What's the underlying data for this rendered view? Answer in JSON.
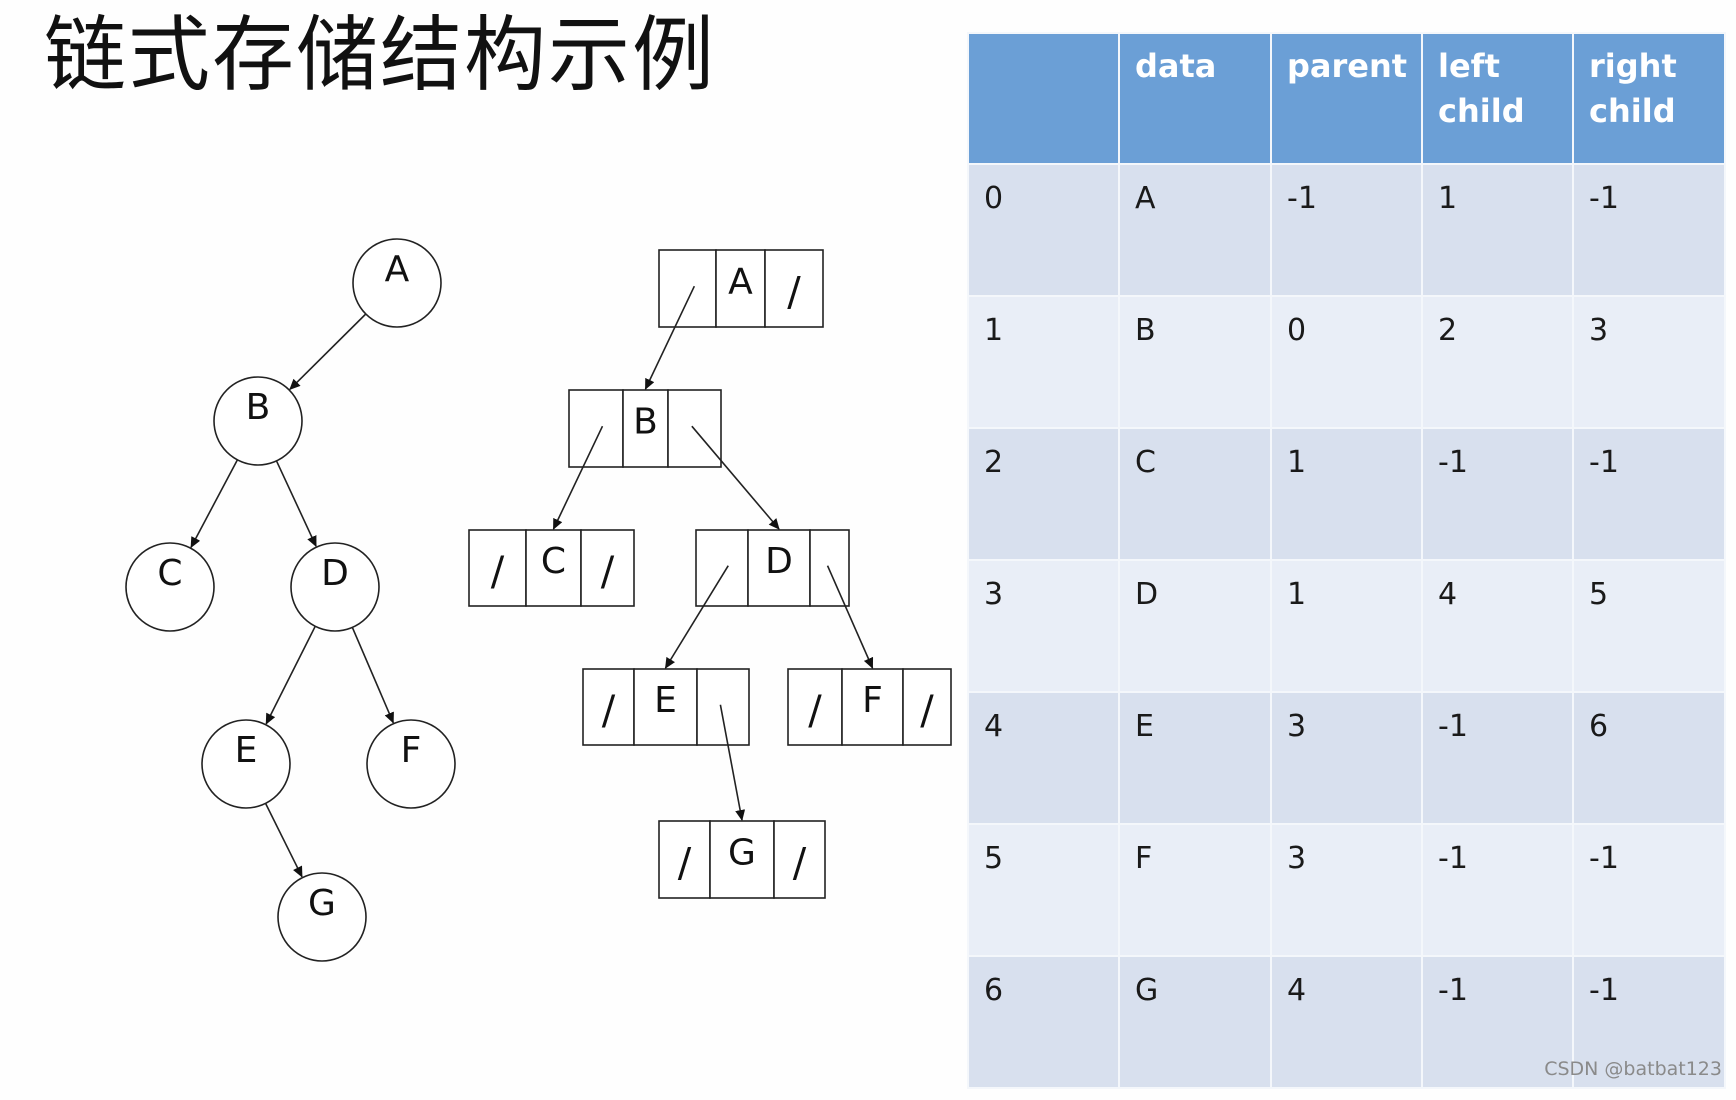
{
  "title": "链式存储结构示例",
  "tree": {
    "nodes": [
      {
        "id": "A",
        "label": "A",
        "left": "B",
        "right": null
      },
      {
        "id": "B",
        "label": "B",
        "left": "C",
        "right": "D"
      },
      {
        "id": "C",
        "label": "C",
        "left": null,
        "right": null
      },
      {
        "id": "D",
        "label": "D",
        "left": "E",
        "right": "F"
      },
      {
        "id": "E",
        "label": "E",
        "left": null,
        "right": "G"
      },
      {
        "id": "F",
        "label": "F",
        "left": null,
        "right": null
      },
      {
        "id": "G",
        "label": "G",
        "left": null,
        "right": null
      }
    ]
  },
  "linked_nodes": {
    "null_symbol": "/",
    "nodes": [
      {
        "id": "A",
        "label": "A",
        "left_null": false,
        "right_null": true
      },
      {
        "id": "B",
        "label": "B",
        "left_null": false,
        "right_null": false
      },
      {
        "id": "C",
        "label": "C",
        "left_null": true,
        "right_null": true
      },
      {
        "id": "D",
        "label": "D",
        "left_null": false,
        "right_null": false
      },
      {
        "id": "E",
        "label": "E",
        "left_null": true,
        "right_null": false
      },
      {
        "id": "F",
        "label": "F",
        "left_null": true,
        "right_null": true
      },
      {
        "id": "G",
        "label": "G",
        "left_null": true,
        "right_null": true
      }
    ]
  },
  "table": {
    "headers": [
      "",
      "data",
      "parent",
      "left\nchild",
      "right\nchild"
    ],
    "header_lines": [
      [
        ""
      ],
      [
        "data"
      ],
      [
        "parent"
      ],
      [
        "left",
        "child"
      ],
      [
        "right",
        "child"
      ]
    ],
    "rows": [
      [
        "0",
        "A",
        "-1",
        "1",
        "-1"
      ],
      [
        "1",
        "B",
        "0",
        "2",
        "3"
      ],
      [
        "2",
        "C",
        "1",
        "-1",
        "-1"
      ],
      [
        "3",
        "D",
        "1",
        "4",
        "5"
      ],
      [
        "4",
        "E",
        "3",
        "-1",
        "6"
      ],
      [
        "5",
        "F",
        "3",
        "-1",
        "-1"
      ],
      [
        "6",
        "G",
        "4",
        "-1",
        "-1"
      ]
    ],
    "colors": {
      "header_bg": "#6b9fd6",
      "row_odd": "#d8e0ee",
      "row_even": "#e9eef7",
      "header_text": "#ffffff"
    }
  },
  "watermark": "CSDN @batbat123"
}
